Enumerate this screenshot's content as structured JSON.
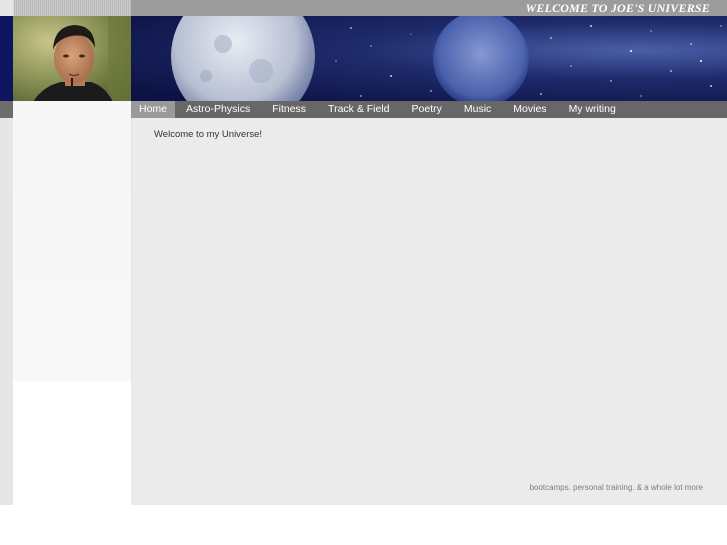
{
  "header": {
    "site_title": "WELCOME TO JOE'S UNIVERSE"
  },
  "nav": {
    "items": [
      {
        "label": "Home",
        "active": true
      },
      {
        "label": "Astro-Physics"
      },
      {
        "label": "Fitness"
      },
      {
        "label": "Track & Field"
      },
      {
        "label": "Poetry"
      },
      {
        "label": "Music"
      },
      {
        "label": "Movies"
      },
      {
        "label": "My writing"
      }
    ]
  },
  "content": {
    "welcome_text": "Welcome to my Universe!",
    "footer_text": "bootcamps. personal training. & a whole lot more"
  },
  "colors": {
    "nav_bg": "#676767",
    "nav_active": "#9a9a9a",
    "content_bg": "#ebebeb",
    "banner_dark": "#0c1244"
  }
}
